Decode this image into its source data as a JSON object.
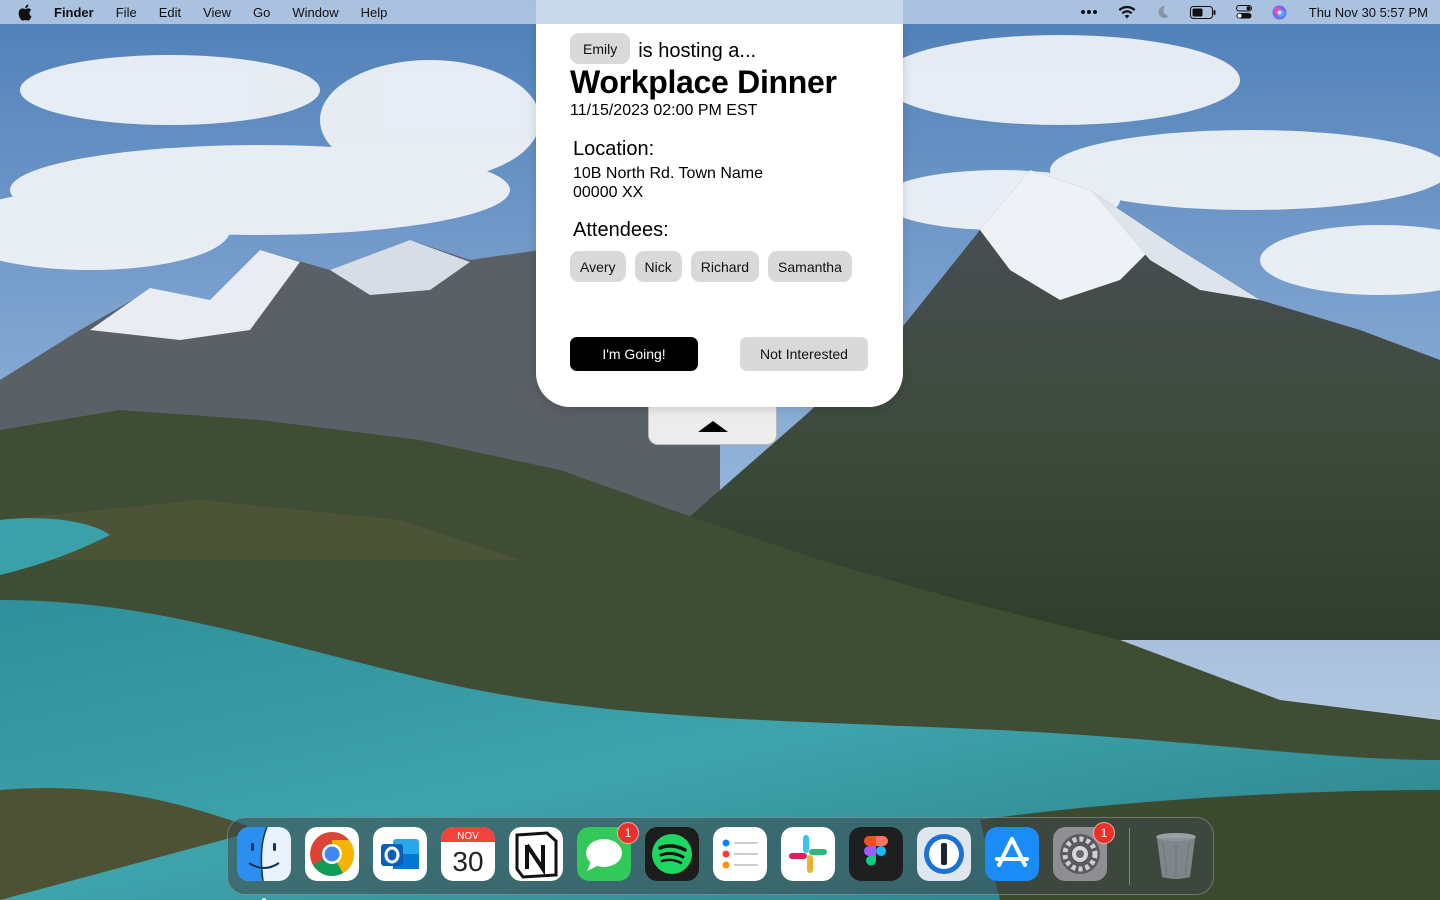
{
  "menubar": {
    "app_name": "Finder",
    "menus": [
      "File",
      "Edit",
      "View",
      "Go",
      "Window",
      "Help"
    ],
    "clock": "Thu Nov 30  5:57 PM",
    "status_icons": [
      "more-icon",
      "wifi-icon",
      "focus-moon-icon",
      "battery-icon",
      "control-center-icon",
      "siri-icon"
    ]
  },
  "event": {
    "host": "Emily",
    "hosting_text": "is hosting a...",
    "title": "Workplace Dinner",
    "datetime": "11/15/2023 02:00 PM EST",
    "location_heading": "Location:",
    "location_line1": "10B North Rd. Town Name",
    "location_line2": "00000 XX",
    "attendees_heading": "Attendees:",
    "attendees": [
      "Avery",
      "Nick",
      "Richard",
      "Samantha"
    ],
    "going_label": "I'm Going!",
    "not_interested_label": "Not Interested"
  },
  "dock": {
    "apps": [
      {
        "name": "Finder",
        "icon": "finder-icon",
        "running": true
      },
      {
        "name": "Chrome",
        "icon": "chrome-icon"
      },
      {
        "name": "Outlook",
        "icon": "outlook-icon"
      },
      {
        "name": "Calendar",
        "icon": "calendar-icon",
        "month": "NOV",
        "day": "30"
      },
      {
        "name": "Notion",
        "icon": "notion-icon"
      },
      {
        "name": "Messages",
        "icon": "messages-icon",
        "badge": "1"
      },
      {
        "name": "Spotify",
        "icon": "spotify-icon"
      },
      {
        "name": "Reminders",
        "icon": "reminders-icon"
      },
      {
        "name": "Slack",
        "icon": "slack-icon"
      },
      {
        "name": "Figma",
        "icon": "figma-icon"
      },
      {
        "name": "1Password",
        "icon": "onepassword-icon"
      },
      {
        "name": "App Store",
        "icon": "app-store-icon"
      },
      {
        "name": "System Settings",
        "icon": "system-settings-icon",
        "badge": "1"
      },
      {
        "name": "Trash",
        "icon": "trash-icon"
      }
    ]
  },
  "colors": {
    "lake": "#3a9aa3",
    "primary_button": "#000000",
    "pill_gray": "#d9d9d9",
    "badge_red": "#e8312a"
  }
}
